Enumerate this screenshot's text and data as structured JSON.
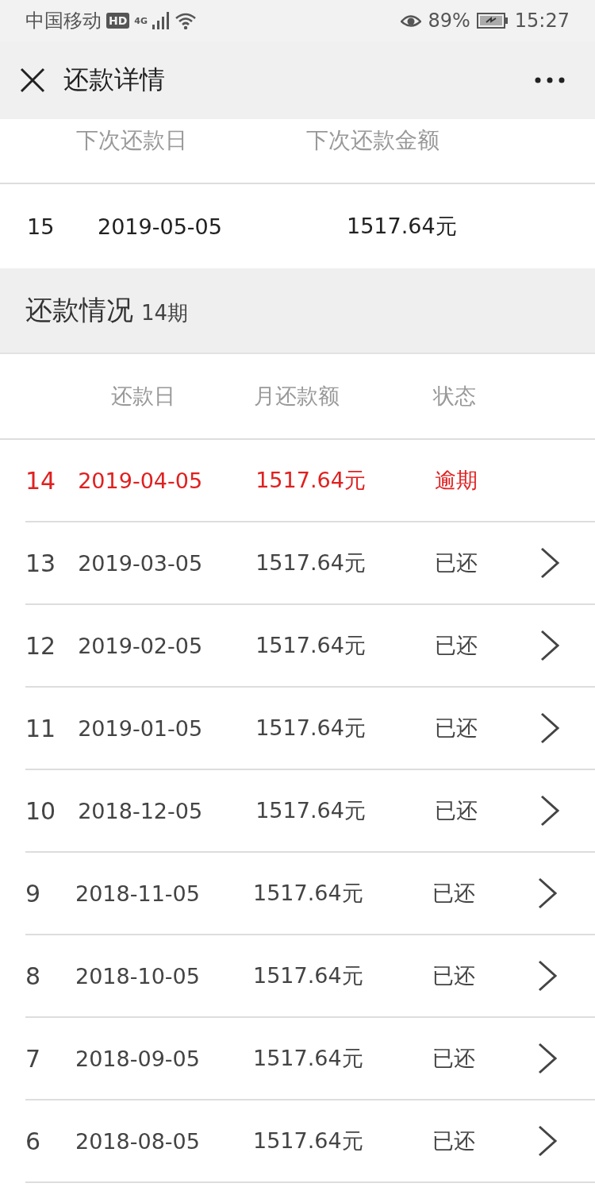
{
  "status_bar": {
    "carrier": "中国移动",
    "hd": "HD",
    "network": "4G",
    "battery": "89%",
    "time": "15:27"
  },
  "header": {
    "title": "还款详情"
  },
  "next_payment": {
    "columns": [
      "下次还款日",
      "下次还款金额"
    ],
    "period": "15",
    "date": "2019-05-05",
    "amount": "1517.64元"
  },
  "section": {
    "title": "还款情况",
    "count": "14期"
  },
  "table": {
    "columns": [
      "还款日",
      "月还款额",
      "状态"
    ],
    "rows": [
      {
        "period": "14",
        "date": "2019-04-05",
        "amount": "1517.64元",
        "status": "逾期",
        "overdue": true
      },
      {
        "period": "13",
        "date": "2019-03-05",
        "amount": "1517.64元",
        "status": "已还",
        "overdue": false
      },
      {
        "period": "12",
        "date": "2019-02-05",
        "amount": "1517.64元",
        "status": "已还",
        "overdue": false
      },
      {
        "period": "11",
        "date": "2019-01-05",
        "amount": "1517.64元",
        "status": "已还",
        "overdue": false
      },
      {
        "period": "10",
        "date": "2018-12-05",
        "amount": "1517.64元",
        "status": "已还",
        "overdue": false
      },
      {
        "period": "9",
        "date": "2018-11-05",
        "amount": "1517.64元",
        "status": "已还",
        "overdue": false
      },
      {
        "period": "8",
        "date": "2018-10-05",
        "amount": "1517.64元",
        "status": "已还",
        "overdue": false
      },
      {
        "period": "7",
        "date": "2018-09-05",
        "amount": "1517.64元",
        "status": "已还",
        "overdue": false
      },
      {
        "period": "6",
        "date": "2018-08-05",
        "amount": "1517.64元",
        "status": "已还",
        "overdue": false
      }
    ]
  }
}
